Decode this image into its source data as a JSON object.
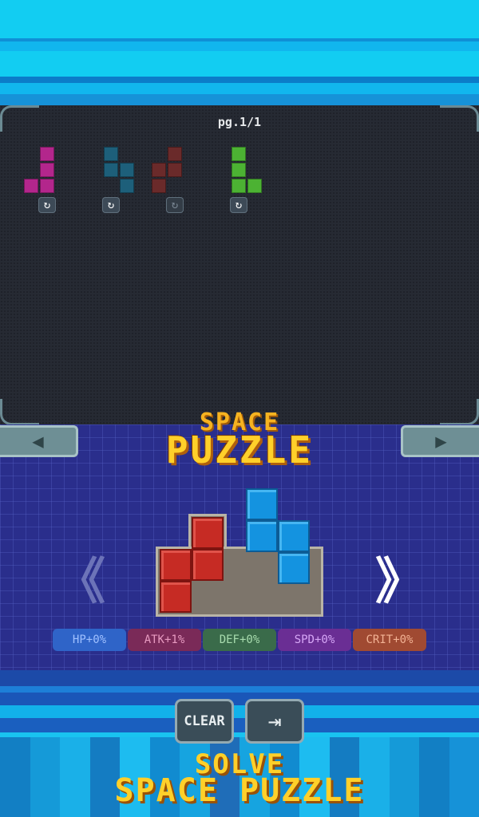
{
  "inventory": {
    "page_indicator": "pg.1/1",
    "rotate_icon": "rotate-icon",
    "pieces": [
      {
        "name": "magenta-j-piece",
        "color": "#b3268c",
        "rotatable": true
      },
      {
        "name": "teal-s-piece",
        "color": "#1d5f7a",
        "rotatable": true
      },
      {
        "name": "dark-red-s-piece",
        "color": "#6a2a2a",
        "rotatable": false
      },
      {
        "name": "green-l-piece",
        "color": "#4cb233",
        "rotatable": true
      }
    ]
  },
  "navigation": {
    "left_tab_icon": "triangle-left-icon",
    "right_tab_icon": "triangle-right-icon",
    "left_tab_glyph": "◀",
    "right_tab_glyph": "▶",
    "prev_glyph": "《",
    "next_glyph": "》"
  },
  "logo": {
    "line1": "SPACE",
    "line2": "PUZZLE"
  },
  "board": {
    "red_piece_color": "#c62b24",
    "blue_piece_color": "#1493e0"
  },
  "stats": [
    {
      "label": "HP+0%",
      "bg": "#2f64c8",
      "fg": "#9fc0ff"
    },
    {
      "label": "ATK+1%",
      "bg": "#7a2a58",
      "fg": "#e79ac0"
    },
    {
      "label": "DEF+0%",
      "bg": "#3a6b4a",
      "fg": "#a8dcae"
    },
    {
      "label": "SPD+0%",
      "bg": "#6a2e94",
      "fg": "#d6a6f6"
    },
    {
      "label": "CRIT+0%",
      "bg": "#a04a32",
      "fg": "#f2b294"
    }
  ],
  "buttons": {
    "clear_label": "CLEAR",
    "exit_icon": "exit-door-icon",
    "exit_glyph": "⇥"
  },
  "footer": {
    "line1": "SOLVE",
    "line2": "SPACE PUZZLE"
  }
}
